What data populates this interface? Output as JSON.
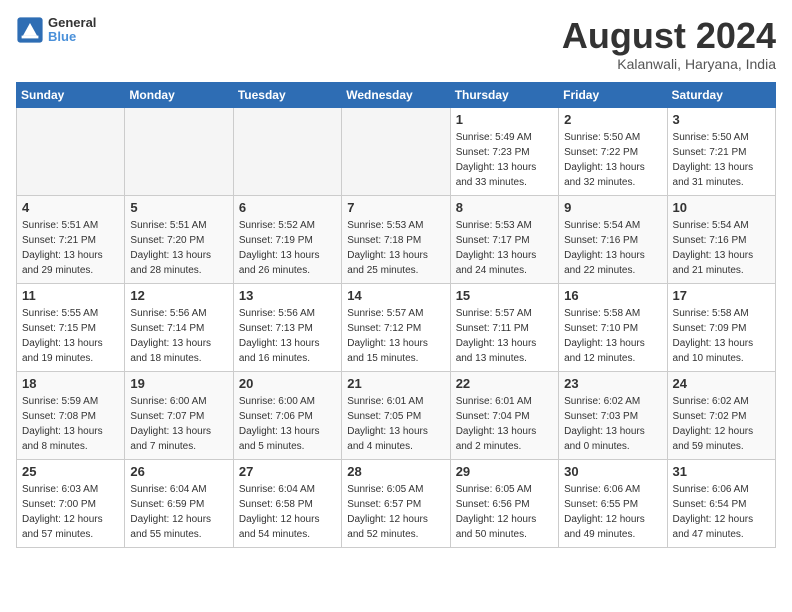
{
  "header": {
    "logo_line1": "General",
    "logo_line2": "Blue",
    "title": "August 2024",
    "subtitle": "Kalanwali, Haryana, India"
  },
  "weekdays": [
    "Sunday",
    "Monday",
    "Tuesday",
    "Wednesday",
    "Thursday",
    "Friday",
    "Saturday"
  ],
  "weeks": [
    [
      {
        "day": "",
        "info": "",
        "empty": true
      },
      {
        "day": "",
        "info": "",
        "empty": true
      },
      {
        "day": "",
        "info": "",
        "empty": true
      },
      {
        "day": "",
        "info": "",
        "empty": true
      },
      {
        "day": "1",
        "info": "Sunrise: 5:49 AM\nSunset: 7:23 PM\nDaylight: 13 hours\nand 33 minutes."
      },
      {
        "day": "2",
        "info": "Sunrise: 5:50 AM\nSunset: 7:22 PM\nDaylight: 13 hours\nand 32 minutes."
      },
      {
        "day": "3",
        "info": "Sunrise: 5:50 AM\nSunset: 7:21 PM\nDaylight: 13 hours\nand 31 minutes."
      }
    ],
    [
      {
        "day": "4",
        "info": "Sunrise: 5:51 AM\nSunset: 7:21 PM\nDaylight: 13 hours\nand 29 minutes."
      },
      {
        "day": "5",
        "info": "Sunrise: 5:51 AM\nSunset: 7:20 PM\nDaylight: 13 hours\nand 28 minutes."
      },
      {
        "day": "6",
        "info": "Sunrise: 5:52 AM\nSunset: 7:19 PM\nDaylight: 13 hours\nand 26 minutes."
      },
      {
        "day": "7",
        "info": "Sunrise: 5:53 AM\nSunset: 7:18 PM\nDaylight: 13 hours\nand 25 minutes."
      },
      {
        "day": "8",
        "info": "Sunrise: 5:53 AM\nSunset: 7:17 PM\nDaylight: 13 hours\nand 24 minutes."
      },
      {
        "day": "9",
        "info": "Sunrise: 5:54 AM\nSunset: 7:16 PM\nDaylight: 13 hours\nand 22 minutes."
      },
      {
        "day": "10",
        "info": "Sunrise: 5:54 AM\nSunset: 7:16 PM\nDaylight: 13 hours\nand 21 minutes."
      }
    ],
    [
      {
        "day": "11",
        "info": "Sunrise: 5:55 AM\nSunset: 7:15 PM\nDaylight: 13 hours\nand 19 minutes."
      },
      {
        "day": "12",
        "info": "Sunrise: 5:56 AM\nSunset: 7:14 PM\nDaylight: 13 hours\nand 18 minutes."
      },
      {
        "day": "13",
        "info": "Sunrise: 5:56 AM\nSunset: 7:13 PM\nDaylight: 13 hours\nand 16 minutes."
      },
      {
        "day": "14",
        "info": "Sunrise: 5:57 AM\nSunset: 7:12 PM\nDaylight: 13 hours\nand 15 minutes."
      },
      {
        "day": "15",
        "info": "Sunrise: 5:57 AM\nSunset: 7:11 PM\nDaylight: 13 hours\nand 13 minutes."
      },
      {
        "day": "16",
        "info": "Sunrise: 5:58 AM\nSunset: 7:10 PM\nDaylight: 13 hours\nand 12 minutes."
      },
      {
        "day": "17",
        "info": "Sunrise: 5:58 AM\nSunset: 7:09 PM\nDaylight: 13 hours\nand 10 minutes."
      }
    ],
    [
      {
        "day": "18",
        "info": "Sunrise: 5:59 AM\nSunset: 7:08 PM\nDaylight: 13 hours\nand 8 minutes."
      },
      {
        "day": "19",
        "info": "Sunrise: 6:00 AM\nSunset: 7:07 PM\nDaylight: 13 hours\nand 7 minutes."
      },
      {
        "day": "20",
        "info": "Sunrise: 6:00 AM\nSunset: 7:06 PM\nDaylight: 13 hours\nand 5 minutes."
      },
      {
        "day": "21",
        "info": "Sunrise: 6:01 AM\nSunset: 7:05 PM\nDaylight: 13 hours\nand 4 minutes."
      },
      {
        "day": "22",
        "info": "Sunrise: 6:01 AM\nSunset: 7:04 PM\nDaylight: 13 hours\nand 2 minutes."
      },
      {
        "day": "23",
        "info": "Sunrise: 6:02 AM\nSunset: 7:03 PM\nDaylight: 13 hours\nand 0 minutes."
      },
      {
        "day": "24",
        "info": "Sunrise: 6:02 AM\nSunset: 7:02 PM\nDaylight: 12 hours\nand 59 minutes."
      }
    ],
    [
      {
        "day": "25",
        "info": "Sunrise: 6:03 AM\nSunset: 7:00 PM\nDaylight: 12 hours\nand 57 minutes."
      },
      {
        "day": "26",
        "info": "Sunrise: 6:04 AM\nSunset: 6:59 PM\nDaylight: 12 hours\nand 55 minutes."
      },
      {
        "day": "27",
        "info": "Sunrise: 6:04 AM\nSunset: 6:58 PM\nDaylight: 12 hours\nand 54 minutes."
      },
      {
        "day": "28",
        "info": "Sunrise: 6:05 AM\nSunset: 6:57 PM\nDaylight: 12 hours\nand 52 minutes."
      },
      {
        "day": "29",
        "info": "Sunrise: 6:05 AM\nSunset: 6:56 PM\nDaylight: 12 hours\nand 50 minutes."
      },
      {
        "day": "30",
        "info": "Sunrise: 6:06 AM\nSunset: 6:55 PM\nDaylight: 12 hours\nand 49 minutes."
      },
      {
        "day": "31",
        "info": "Sunrise: 6:06 AM\nSunset: 6:54 PM\nDaylight: 12 hours\nand 47 minutes."
      }
    ]
  ]
}
